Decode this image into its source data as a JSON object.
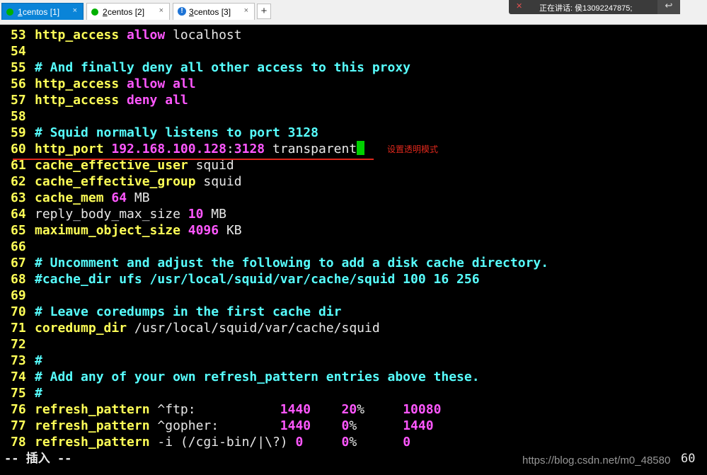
{
  "tabs": [
    {
      "num": "1",
      "label": " centos [1]",
      "status": "connected",
      "active": true
    },
    {
      "num": "2",
      "label": " centos [2]",
      "status": "connected",
      "active": false
    },
    {
      "num": "3",
      "label": " centos [3]",
      "status": "warning",
      "active": false
    }
  ],
  "tab_close": "×",
  "add_tab": "+",
  "speaking": {
    "text": "正在讲话: 侯13092247875;",
    "mic_icon": "✕",
    "reply_icon": "↩"
  },
  "colors": {
    "keyword": "#ffff57",
    "value": "#ff57ff",
    "comment": "#57ffff",
    "plain": "#e8e8e8",
    "cursor": "#00d000",
    "annotation": "#e0281c",
    "active_tab": "#0a84d8"
  },
  "lines": [
    {
      "n": "53",
      "parts": [
        [
          "kw",
          "http_access "
        ],
        [
          "mg",
          "allow"
        ],
        [
          "wh",
          " localhost"
        ]
      ]
    },
    {
      "n": "54",
      "parts": []
    },
    {
      "n": "55",
      "parts": [
        [
          "cy",
          "# And finally deny all other access to this proxy"
        ]
      ]
    },
    {
      "n": "56",
      "parts": [
        [
          "kw",
          "http_access "
        ],
        [
          "mg",
          "allow all"
        ]
      ]
    },
    {
      "n": "57",
      "parts": [
        [
          "kw",
          "http_access "
        ],
        [
          "mg",
          "deny all"
        ]
      ]
    },
    {
      "n": "58",
      "parts": []
    },
    {
      "n": "59",
      "parts": [
        [
          "cy",
          "# Squid normally listens to port 3128"
        ]
      ]
    },
    {
      "n": "60",
      "parts": [
        [
          "kw",
          "http_port "
        ],
        [
          "mg",
          "192.168.100.128"
        ],
        [
          "wh",
          ":"
        ],
        [
          "mg",
          "3128"
        ],
        [
          "wh",
          " transparent"
        ]
      ],
      "cursor": true
    },
    {
      "n": "61",
      "parts": [
        [
          "kw",
          "cache_effective_user "
        ],
        [
          "wh",
          "squid"
        ]
      ]
    },
    {
      "n": "62",
      "parts": [
        [
          "kw",
          "cache_effective_group "
        ],
        [
          "wh",
          "squid"
        ]
      ]
    },
    {
      "n": "63",
      "parts": [
        [
          "kw",
          "cache_mem "
        ],
        [
          "mg",
          "64"
        ],
        [
          "wh",
          " MB"
        ]
      ]
    },
    {
      "n": "64",
      "parts": [
        [
          "wh",
          "reply_body_max_size "
        ],
        [
          "mg",
          "10"
        ],
        [
          "wh",
          " MB"
        ]
      ]
    },
    {
      "n": "65",
      "parts": [
        [
          "kw",
          "maximum_object_size "
        ],
        [
          "mg",
          "4096"
        ],
        [
          "wh",
          " KB"
        ]
      ]
    },
    {
      "n": "66",
      "parts": []
    },
    {
      "n": "67",
      "parts": [
        [
          "cy",
          "# Uncomment and adjust the following to add a disk cache directory."
        ]
      ]
    },
    {
      "n": "68",
      "parts": [
        [
          "cy",
          "#cache_dir ufs /usr/local/squid/var/cache/squid 100 16 256"
        ]
      ]
    },
    {
      "n": "69",
      "parts": []
    },
    {
      "n": "70",
      "parts": [
        [
          "cy",
          "# Leave coredumps in the first cache dir"
        ]
      ]
    },
    {
      "n": "71",
      "parts": [
        [
          "kw",
          "coredump_dir "
        ],
        [
          "wh",
          "/usr/local/squid/var/cache/squid"
        ]
      ]
    },
    {
      "n": "72",
      "parts": []
    },
    {
      "n": "73",
      "parts": [
        [
          "cy",
          "#"
        ]
      ]
    },
    {
      "n": "74",
      "parts": [
        [
          "cy",
          "# Add any of your own refresh_pattern entries above these."
        ]
      ]
    },
    {
      "n": "75",
      "parts": [
        [
          "cy",
          "#"
        ]
      ]
    },
    {
      "n": "76",
      "parts": [
        [
          "kw",
          "refresh_pattern "
        ],
        [
          "wh",
          "^ftp:           "
        ],
        [
          "mg",
          "1440"
        ],
        [
          "wh",
          "    "
        ],
        [
          "mg",
          "20"
        ],
        [
          "wh",
          "%     "
        ],
        [
          "mg",
          "10080"
        ]
      ]
    },
    {
      "n": "77",
      "parts": [
        [
          "kw",
          "refresh_pattern "
        ],
        [
          "wh",
          "^gopher:        "
        ],
        [
          "mg",
          "1440"
        ],
        [
          "wh",
          "    "
        ],
        [
          "mg",
          "0"
        ],
        [
          "wh",
          "%      "
        ],
        [
          "mg",
          "1440"
        ]
      ]
    },
    {
      "n": "78",
      "parts": [
        [
          "kw",
          "refresh_pattern "
        ],
        [
          "wh",
          "-i (/cgi-bin/|\\?) "
        ],
        [
          "mg",
          "0"
        ],
        [
          "wh",
          "     "
        ],
        [
          "mg",
          "0"
        ],
        [
          "wh",
          "%      "
        ],
        [
          "mg",
          "0"
        ]
      ]
    }
  ],
  "annotation": "设置透明模式",
  "status_mode": "-- 插入 --",
  "cursor_pos": "60",
  "watermark": "https://blog.csdn.net/m0_48580"
}
